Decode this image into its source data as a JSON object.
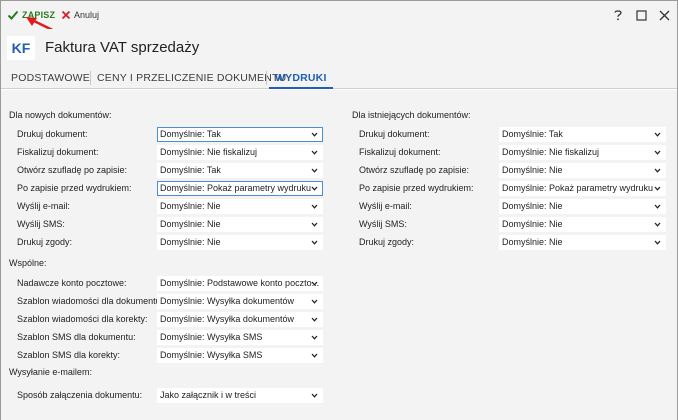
{
  "toolbar": {
    "save_label": "ZAPISZ",
    "cancel_label": "Anuluj",
    "save_color": "#2a7a1e",
    "cancel_color": "#d62020"
  },
  "window_controls": [
    "help-icon",
    "maximize-icon",
    "close-icon"
  ],
  "header": {
    "avatar": "KF",
    "title": "Faktura VAT sprzedaży"
  },
  "tabs": [
    {
      "label": "PODSTAWOWE",
      "active": false
    },
    {
      "label": "CENY I PRZELICZENIE DOKUMENTU",
      "active": false
    },
    {
      "label": "WYDRUKI",
      "active": true
    }
  ],
  "sections": {
    "new_docs": {
      "title": "Dla nowych dokumentów:",
      "rows": [
        {
          "label": "Drukuj dokument:",
          "value": "Domyślnie: Tak"
        },
        {
          "label": "Fiskalizuj dokument:",
          "value": "Domyślnie: Nie fiskalizuj"
        },
        {
          "label": "Otwórz szufladę po zapisie:",
          "value": "Domyślnie: Tak"
        },
        {
          "label": "Po zapisie przed wydrukiem:",
          "value": "Domyślnie: Pokaż parametry wydruku"
        },
        {
          "label": "Wyślij e-mail:",
          "value": "Domyślnie: Nie"
        },
        {
          "label": "Wyślij SMS:",
          "value": "Domyślnie: Nie"
        },
        {
          "label": "Drukuj zgody:",
          "value": "Domyślnie: Nie"
        }
      ]
    },
    "existing_docs": {
      "title": "Dla istniejących dokumentów:",
      "rows": [
        {
          "label": "Drukuj dokument:",
          "value": "Domyślnie: Tak"
        },
        {
          "label": "Fiskalizuj dokument:",
          "value": "Domyślnie: Nie fiskalizuj"
        },
        {
          "label": "Otwórz szufladę po zapisie:",
          "value": "Domyślnie: Nie"
        },
        {
          "label": "Po zapisie przed wydrukiem:",
          "value": "Domyślnie: Pokaż parametry wydruku"
        },
        {
          "label": "Wyślij e-mail:",
          "value": "Domyślnie: Nie"
        },
        {
          "label": "Wyślij SMS:",
          "value": "Domyślnie: Nie"
        },
        {
          "label": "Drukuj zgody:",
          "value": "Domyślnie: Nie"
        }
      ]
    },
    "common": {
      "title": "Wspólne:",
      "rows": [
        {
          "label": "Nadawcze konto pocztowe:",
          "value": "Domyślnie: Podstawowe konto poczto..."
        },
        {
          "label": "Szablon wiadomości dla dokumentu:",
          "value": "Domyślnie: Wysyłka dokumentów"
        },
        {
          "label": "Szablon wiadomości dla korekty:",
          "value": "Domyślnie: Wysyłka dokumentów"
        },
        {
          "label": "Szablon SMS dla dokumentu:",
          "value": "Domyślnie: Wysyłka SMS"
        },
        {
          "label": "Szablon SMS dla korekty:",
          "value": "Domyślnie: Wysyłka SMS"
        }
      ]
    },
    "email": {
      "title": "Wysyłanie e-mailem:",
      "rows": [
        {
          "label": "Sposób załączenia dokumentu:",
          "value": "Jako załącznik i w treści"
        }
      ]
    }
  },
  "colors": {
    "accent": "#1f5fb4",
    "annotation_arrow": "#e01b1b"
  }
}
